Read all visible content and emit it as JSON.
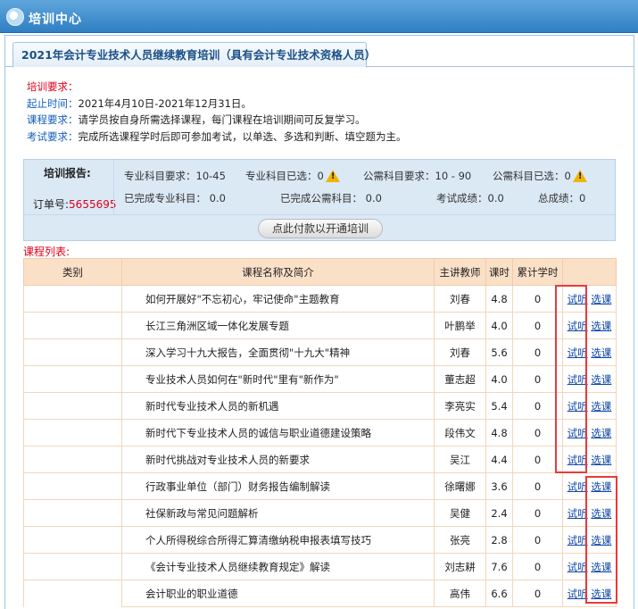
{
  "window": {
    "title": "培训中心"
  },
  "tab": {
    "label": "2021年会计专业技术人员继续教育培训（具有会计专业技术资格人员）"
  },
  "requirements": {
    "header": "培训要求：",
    "items": [
      {
        "label": "起止时间：",
        "value": "2021年4月10日-2021年12月31日。"
      },
      {
        "label": "课程要求：",
        "value": "请学员按自身所需选择课程，每门课程在培训期间可反复学习。"
      },
      {
        "label": "考试要求：",
        "value": "完成所选课程学时后即可参加考试，以单选、多选和判断、填空题为主。"
      }
    ]
  },
  "report": {
    "label": "培训报告:",
    "order_label": "订单号:",
    "order_number": "5655695",
    "pro_required": "专业科目要求：10-45",
    "pro_selected": "专业科目已选：0",
    "pub_required": "公需科目要求：10 - 90",
    "pub_selected": "公需科目已选：0",
    "pro_done": "已完成专业科目：   0.0",
    "pub_done": "已完成公需科目：   0.0",
    "exam_score": "考试成绩：0.0",
    "total_score": "总成绩：0",
    "pay_button": "点此付款以开通培训",
    "warning_icon": "warning-triangle-icon"
  },
  "course_list": {
    "label": "课程列表:",
    "headers": [
      "类别",
      "课程名称及简介",
      "主讲教师",
      "课时",
      "累计学时",
      ""
    ],
    "audit_label": "试听",
    "select_label": "选课",
    "rows": [
      {
        "name": "如何开展好\"不忘初心，牢记使命\"主题教育",
        "teacher": "刘春",
        "hours": "4.8",
        "acc": "0"
      },
      {
        "name": "长江三角洲区域一体化发展专题",
        "teacher": "叶鹏举",
        "hours": "4.0",
        "acc": "0"
      },
      {
        "name": "深入学习十九大报告，全面贯彻\"十九大\"精神",
        "teacher": "刘春",
        "hours": "5.6",
        "acc": "0"
      },
      {
        "name": "专业技术人员如何在\"新时代\"里有\"新作为\"",
        "teacher": "董志超",
        "hours": "4.0",
        "acc": "0"
      },
      {
        "name": "新时代专业技术人员的新机遇",
        "teacher": "李亮实",
        "hours": "5.4",
        "acc": "0"
      },
      {
        "name": "新时代下专业技术人员的诚信与职业道德建设策略",
        "teacher": "段伟文",
        "hours": "4.8",
        "acc": "0"
      },
      {
        "name": "新时代挑战对专业技术人员的新要求",
        "teacher": "吴江",
        "hours": "4.4",
        "acc": "0"
      },
      {
        "name": "行政事业单位（部门）财务报告编制解读",
        "teacher": "徐曙娜",
        "hours": "3.6",
        "acc": "0"
      },
      {
        "name": "社保新政与常见问题解析",
        "teacher": "吴健",
        "hours": "2.4",
        "acc": "0"
      },
      {
        "name": "个人所得税综合所得汇算清缴纳税申报表填写技巧",
        "teacher": "张亮",
        "hours": "2.8",
        "acc": "0"
      },
      {
        "name": "《会计专业技术人员继续教育规定》解读",
        "teacher": "刘志耕",
        "hours": "7.6",
        "acc": "0"
      },
      {
        "name": "会计职业的职业道德",
        "teacher": "高伟",
        "hours": "6.6",
        "acc": "0"
      }
    ]
  },
  "colors": {
    "titlebar": "#3f8ed0",
    "highlight": "#e83a3a",
    "accent_red": "#e0001b",
    "link": "#1148a8",
    "table_header": "#fbe0c8"
  }
}
